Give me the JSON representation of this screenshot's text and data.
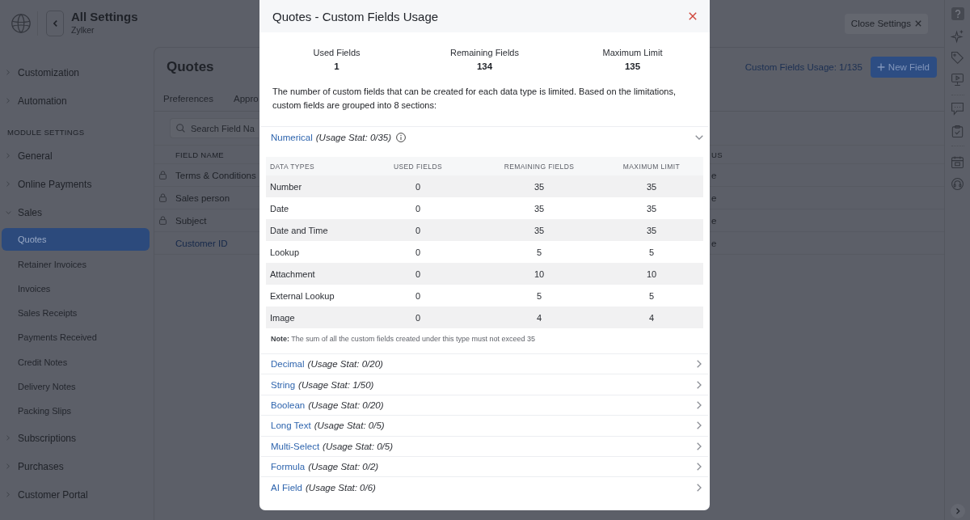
{
  "header": {
    "title": "All Settings",
    "organization": "Zylker",
    "close_button": "Close Settings"
  },
  "sidebar": {
    "items": [
      {
        "label": "Customization",
        "expanded": false
      },
      {
        "label": "Automation",
        "expanded": false
      }
    ],
    "module_heading": "MODULE SETTINGS",
    "module_items": [
      {
        "label": "General",
        "expanded": false
      },
      {
        "label": "Online Payments",
        "expanded": false
      },
      {
        "label": "Sales",
        "expanded": true,
        "children": [
          {
            "label": "Quotes",
            "selected": true
          },
          {
            "label": "Retainer Invoices",
            "selected": false
          },
          {
            "label": "Invoices",
            "selected": false
          },
          {
            "label": "Sales Receipts",
            "selected": false
          },
          {
            "label": "Payments Received",
            "selected": false
          },
          {
            "label": "Credit Notes",
            "selected": false
          },
          {
            "label": "Delivery Notes",
            "selected": false
          },
          {
            "label": "Packing Slips",
            "selected": false
          }
        ]
      },
      {
        "label": "Subscriptions",
        "expanded": false
      },
      {
        "label": "Purchases",
        "expanded": false
      },
      {
        "label": "Customer Portal",
        "expanded": false
      }
    ]
  },
  "main": {
    "title": "Quotes",
    "usage": "Custom Fields Usage: 1/135",
    "new_button": "New Field",
    "tabs": [
      {
        "label": "Preferences",
        "selected": false
      },
      {
        "label": "Appro",
        "selected": false
      }
    ],
    "search": {
      "placeholder": "Search Field Na"
    },
    "table": {
      "columns": [
        "FIELD NAME",
        "US"
      ],
      "rows": [
        {
          "field_name": "Terms & Conditions",
          "locked": true,
          "column_2": "e"
        },
        {
          "field_name": "Sales person",
          "locked": true,
          "column_2": "e"
        },
        {
          "field_name": "Subject",
          "locked": true,
          "column_2": "e"
        },
        {
          "field_name": "Customer ID",
          "locked": false,
          "column_2": "e"
        }
      ]
    }
  },
  "modal": {
    "title": "Quotes - Custom Fields Usage",
    "stats": [
      {
        "label": "Used Fields",
        "value": "1"
      },
      {
        "label": "Remaining Fields",
        "value": "134"
      },
      {
        "label": "Maximum Limit",
        "value": "135"
      }
    ],
    "description": "The number of custom fields that can be created for each data type is limited. Based on the limitations, custom fields are grouped into 8 sections:",
    "sections": [
      {
        "name": "Numerical",
        "usage": "(Usage Stat: 0/35)",
        "expanded": true,
        "table": {
          "columns": [
            "DATA TYPES",
            "USED FIELDS",
            "REMAINING FIELDS",
            "MAXIMUM LIMIT"
          ],
          "rows": [
            [
              "Number",
              "0",
              "35",
              "35"
            ],
            [
              "Date",
              "0",
              "35",
              "35"
            ],
            [
              "Date and Time",
              "0",
              "35",
              "35"
            ],
            [
              "Lookup",
              "0",
              "5",
              "5"
            ],
            [
              "Attachment",
              "0",
              "10",
              "10"
            ],
            [
              "External Lookup",
              "0",
              "5",
              "5"
            ],
            [
              "Image",
              "0",
              "4",
              "4"
            ]
          ]
        },
        "note": "**Note:** The sum of all the custom fields created under this type must not exceed 35"
      },
      {
        "name": "Decimal",
        "usage": "(Usage Stat: 0/20)",
        "expanded": false
      },
      {
        "name": "String",
        "usage": "(Usage Stat: 1/50)",
        "expanded": false
      },
      {
        "name": "Boolean",
        "usage": "(Usage Stat: 0/20)",
        "expanded": false
      },
      {
        "name": "Long Text",
        "usage": "(Usage Stat: 0/5)",
        "expanded": false
      },
      {
        "name": "Multi-Select",
        "usage": "(Usage Stat: 0/5)",
        "expanded": false
      },
      {
        "name": "Formula",
        "usage": "(Usage Stat: 0/2)",
        "expanded": false
      },
      {
        "name": "AI Field",
        "usage": "(Usage Stat: 0/6)",
        "expanded": false
      }
    ]
  }
}
